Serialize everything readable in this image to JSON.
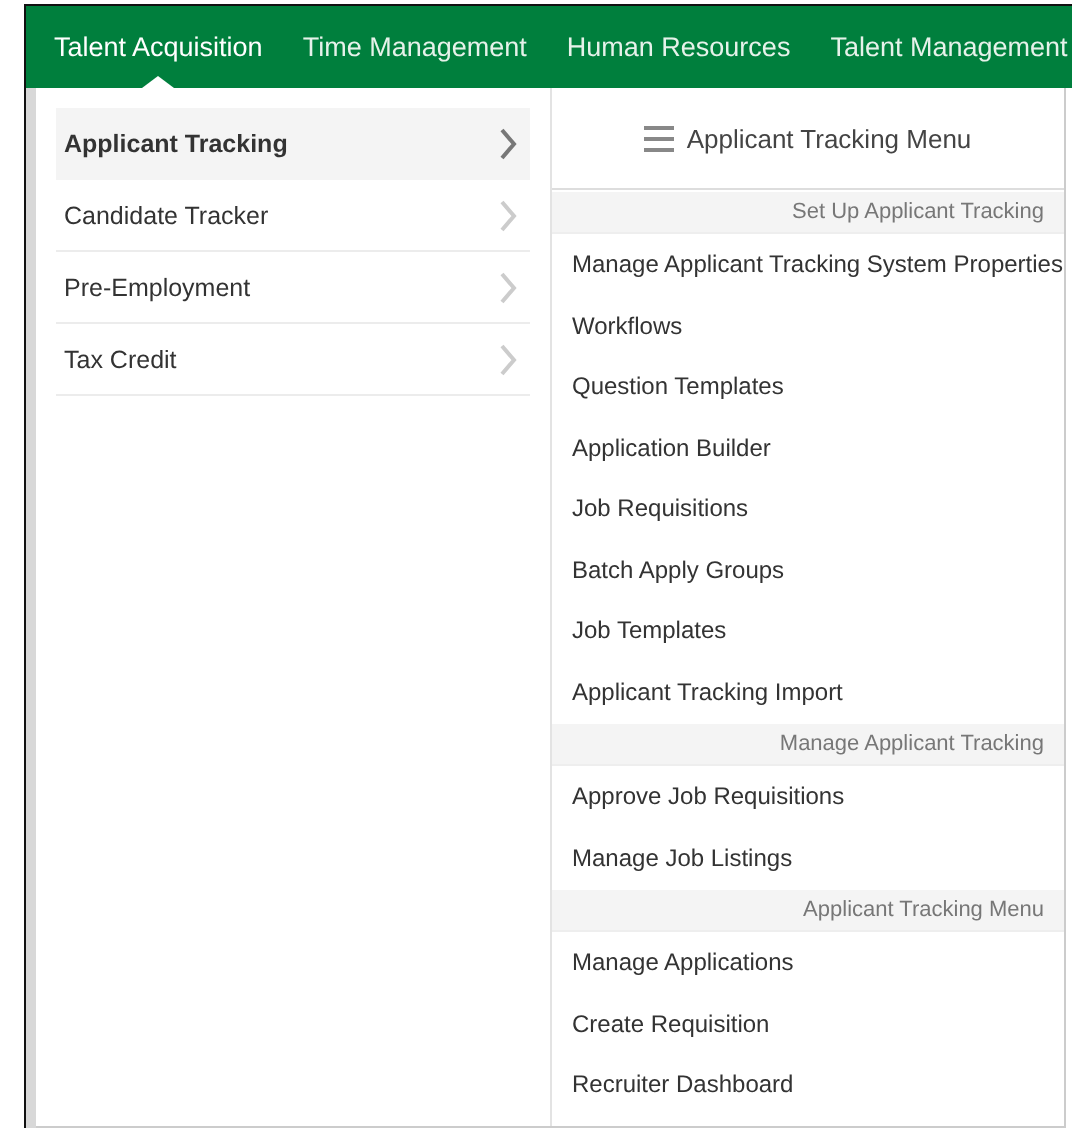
{
  "nav": [
    {
      "label": "Talent Acquisition",
      "selected": true
    },
    {
      "label": "Time Management",
      "selected": false
    },
    {
      "label": "Human Resources",
      "selected": false
    },
    {
      "label": "Talent Management",
      "selected": false
    }
  ],
  "submenu": {
    "items": [
      {
        "label": "Applicant Tracking",
        "selected": true
      },
      {
        "label": "Candidate Tracker",
        "selected": false
      },
      {
        "label": "Pre-Employment",
        "selected": false
      },
      {
        "label": "Tax Credit",
        "selected": false
      }
    ]
  },
  "panel": {
    "title": "Applicant Tracking Menu",
    "sections": [
      {
        "heading": "Set Up Applicant Tracking",
        "items": [
          "Manage Applicant Tracking System Properties",
          "Workflows",
          "Question Templates",
          "Application Builder",
          "Job Requisitions",
          "Batch Apply Groups",
          "Job Templates",
          "Applicant Tracking Import"
        ]
      },
      {
        "heading": "Manage Applicant Tracking",
        "items": [
          "Approve Job Requisitions",
          "Manage Job Listings"
        ]
      },
      {
        "heading": "Applicant Tracking Menu",
        "items": [
          "Manage Applications",
          "Create Requisition",
          "Recruiter Dashboard"
        ]
      }
    ]
  }
}
